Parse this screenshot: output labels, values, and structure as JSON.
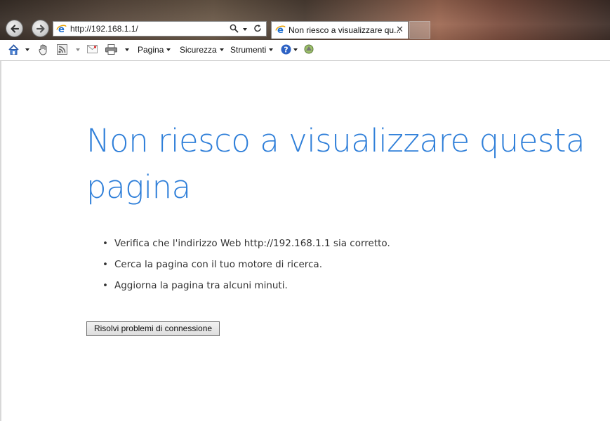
{
  "browser": {
    "address_bar": {
      "url": "http://192.168.1.1/"
    },
    "tab": {
      "title": "Non riesco a visualizzare qu...",
      "close_glyph": "✕"
    }
  },
  "command_bar": {
    "menus": [
      {
        "label": "Pagina"
      },
      {
        "label": "Sicurezza"
      },
      {
        "label": "Strumenti"
      }
    ],
    "icons": [
      "home-icon",
      "hand-icon",
      "feeds-icon",
      "mail-icon",
      "print-icon",
      "help-icon",
      "research-icon"
    ]
  },
  "page": {
    "heading": "Non riesco a visualizzare questa pagina",
    "tips": [
      "Verifica che l'indirizzo Web http://192.168.1.1 sia corretto.",
      "Cerca la pagina con il tuo motore di ricerca.",
      "Aggiorna la pagina tra alcuni minuti."
    ],
    "fix_button": "Risolvi problemi di connessione"
  },
  "colors": {
    "heading": "#2f7fd9",
    "ie_blue": "#1e6fd0",
    "ie_ring": "#e8a100"
  }
}
